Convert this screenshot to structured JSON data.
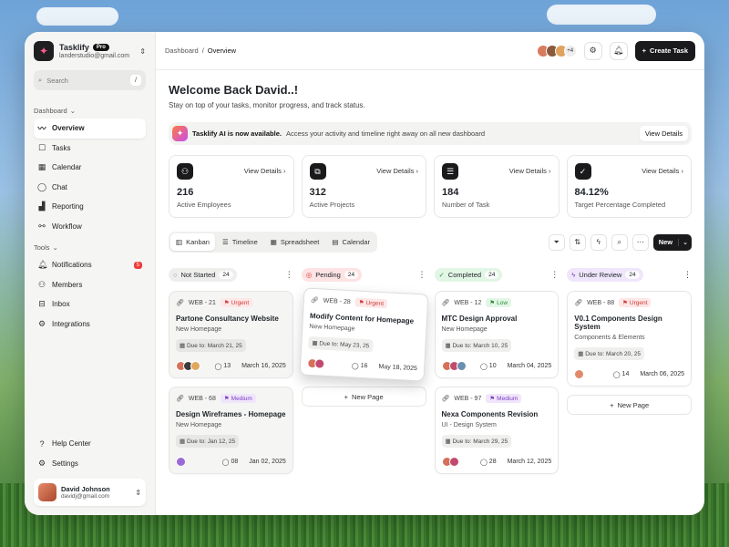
{
  "workspace": {
    "name": "Tasklify",
    "badge": "Pro",
    "email": "landerstudio@gmail.com"
  },
  "search": {
    "placeholder": "Search",
    "shortcut": "/"
  },
  "nav": {
    "dashboard_label": "Dashboard",
    "items": [
      "Overview",
      "Tasks",
      "Calendar",
      "Chat",
      "Reporting",
      "Workflow"
    ],
    "tools_label": "Tools",
    "tools": [
      {
        "label": "Notifications",
        "badge": "5"
      },
      {
        "label": "Members"
      },
      {
        "label": "Inbox"
      },
      {
        "label": "Integrations"
      }
    ],
    "bottom": [
      "Help Center",
      "Settings"
    ]
  },
  "user": {
    "name": "David Johnson",
    "email": "davidj@gmail.com"
  },
  "topbar": {
    "breadcrumb": [
      "Dashboard",
      "/",
      "Overview"
    ],
    "avatars_more": "+4",
    "create_label": "Create Task"
  },
  "welcome": {
    "title": "Welcome Back David..!",
    "subtitle": "Stay on top of your tasks, monitor progress, and track status."
  },
  "banner": {
    "bold": "Tasklify AI is now available.",
    "text": "Access your activity and timeline right away on all new dashboard",
    "button": "View Details"
  },
  "stats": [
    {
      "value": "216",
      "label": "Active Employees",
      "link": "View Details"
    },
    {
      "value": "312",
      "label": "Active Projects",
      "link": "View Details"
    },
    {
      "value": "184",
      "label": "Number of Task",
      "link": "View Details"
    },
    {
      "value": "84.12%",
      "label": "Target Percentage Completed",
      "link": "View Details"
    }
  ],
  "views": [
    "Kanban",
    "Timeline",
    "Spreadsheet",
    "Calendar"
  ],
  "new_label": "New",
  "columns": [
    {
      "name": "Not Started",
      "count": "24",
      "cards": [
        {
          "id": "WEB - 21",
          "prio": "Urgent",
          "title": "Partone Consultancy Website",
          "sub": "New Homepage",
          "due_label": "Due to:",
          "due": "March 21, 25",
          "comments": "13",
          "date": "March 16, 2025"
        },
        {
          "id": "WEB - 68",
          "prio": "Medium",
          "title": "Design Wireframes - Homepage",
          "sub": "New Homepage",
          "due_label": "Due to:",
          "due": "Jan 12, 25",
          "comments": "08",
          "date": "Jan 02, 2025"
        }
      ]
    },
    {
      "name": "Pending",
      "count": "24",
      "cards": [
        {
          "id": "WEB - 28",
          "prio": "Urgent",
          "title": "Modify Content for Homepage",
          "sub": "New Homepage",
          "due_label": "Due to:",
          "due": "May 23, 25",
          "comments": "16",
          "date": "May 18, 2025"
        }
      ],
      "new_page": "New Page"
    },
    {
      "name": "Completed",
      "count": "24",
      "cards": [
        {
          "id": "WEB - 12",
          "prio": "Low",
          "title": "MTC Design Approval",
          "sub": "New Homepage",
          "due_label": "Due to:",
          "due": "March 10, 25",
          "comments": "10",
          "date": "March 04, 2025"
        },
        {
          "id": "WEB - 97",
          "prio": "Medium",
          "title": "Nexa Components Revision",
          "sub": "UI - Design System",
          "due_label": "Due to:",
          "due": "March 29, 25",
          "comments": "28",
          "date": "March 12, 2025"
        }
      ]
    },
    {
      "name": "Under Review",
      "count": "24",
      "cards": [
        {
          "id": "WEB - 88",
          "prio": "Urgent",
          "title": "V0.1 Components Design System",
          "sub": "Components & Elements",
          "due_label": "Due to:",
          "due": "March 20, 25",
          "comments": "14",
          "date": "March 06, 2025"
        }
      ],
      "new_page": "New Page"
    }
  ]
}
